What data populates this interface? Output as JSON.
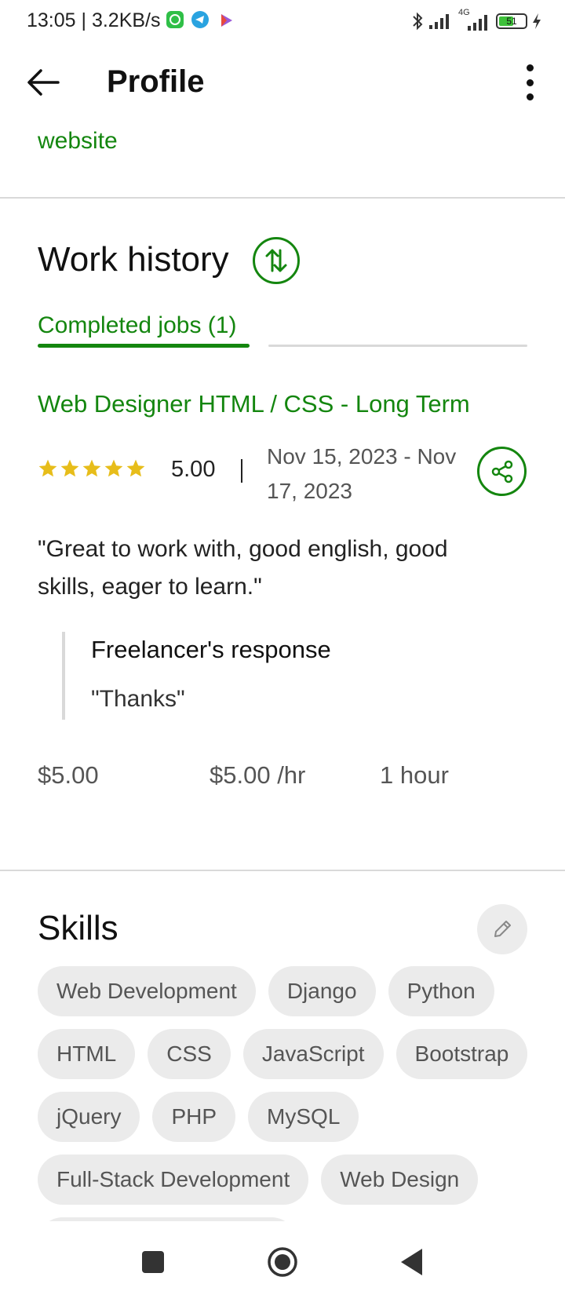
{
  "status_bar": {
    "time_speed": "13:05 | 3.2KB/s",
    "network": "4G",
    "battery": "51"
  },
  "app_bar": {
    "title": "Profile"
  },
  "profile": {
    "website_link": "website"
  },
  "work_history": {
    "heading": "Work history",
    "tab_completed": "Completed jobs (1)",
    "job": {
      "title": "Web Designer HTML / CSS - Long Term",
      "stars": 5,
      "rating": "5.00",
      "dates": "Nov 15, 2023 - Nov 17, 2023",
      "feedback": "\"Great to work with, good english, good skills, eager to learn.\"",
      "response_title": "Freelancer's response",
      "response_text": "\"Thanks\"",
      "earned": "$5.00",
      "rate": "$5.00 /hr",
      "duration": "1 hour"
    }
  },
  "skills": {
    "heading": "Skills",
    "items": [
      "Web Development",
      "Django",
      "Python",
      "HTML",
      "CSS",
      "JavaScript",
      "Bootstrap",
      "jQuery",
      "PHP",
      "MySQL",
      "Full-Stack Development",
      "Web Design",
      ""
    ]
  },
  "colors": {
    "accent": "#14860f",
    "star": "#e7bd1a",
    "chip_bg": "#ebebeb"
  }
}
